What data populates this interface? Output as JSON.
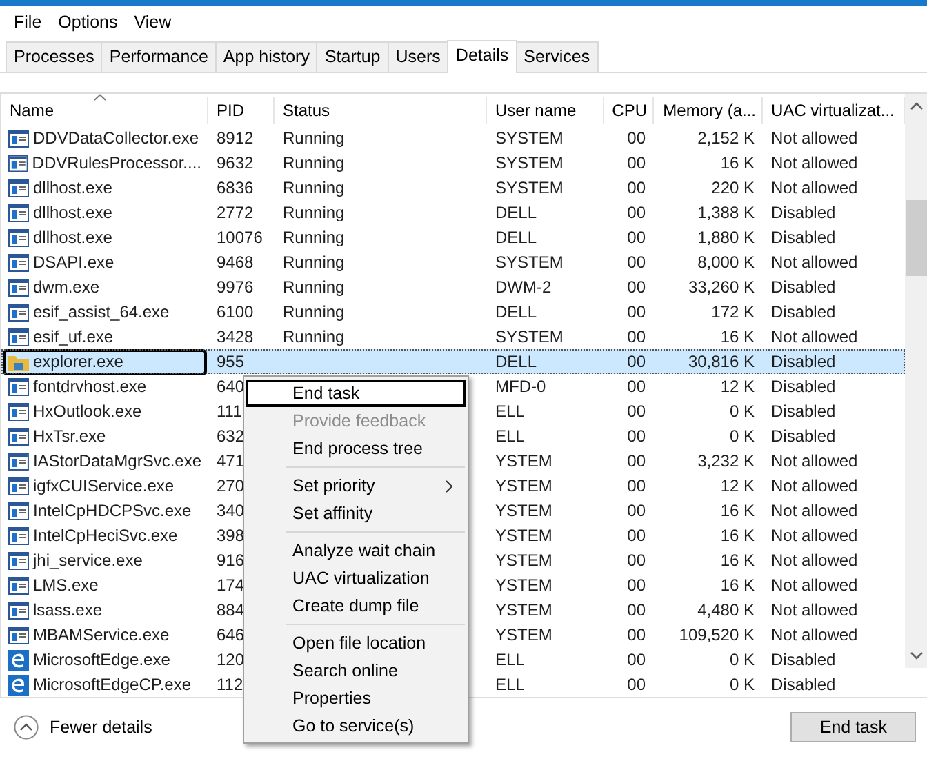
{
  "menu_bar": [
    "File",
    "Options",
    "View"
  ],
  "tabs": [
    {
      "label": "Processes",
      "selected": false
    },
    {
      "label": "Performance",
      "selected": false
    },
    {
      "label": "App history",
      "selected": false
    },
    {
      "label": "Startup",
      "selected": false
    },
    {
      "label": "Users",
      "selected": false
    },
    {
      "label": "Details",
      "selected": true
    },
    {
      "label": "Services",
      "selected": false
    }
  ],
  "table": {
    "columns": [
      "Name",
      "PID",
      "Status",
      "User name",
      "CPU",
      "Memory (a...",
      "UAC virtualizat..."
    ],
    "rows": [
      {
        "kind": "app",
        "selected": false,
        "cells": [
          "DDVDataCollector.exe",
          "8912",
          "Running",
          "SYSTEM",
          "00",
          "2,152 K",
          "Not allowed"
        ]
      },
      {
        "kind": "app",
        "selected": false,
        "cells": [
          "DDVRulesProcessor....",
          "9632",
          "Running",
          "SYSTEM",
          "00",
          "16 K",
          "Not allowed"
        ]
      },
      {
        "kind": "app",
        "selected": false,
        "cells": [
          "dllhost.exe",
          "6836",
          "Running",
          "SYSTEM",
          "00",
          "220 K",
          "Not allowed"
        ]
      },
      {
        "kind": "app",
        "selected": false,
        "cells": [
          "dllhost.exe",
          "2772",
          "Running",
          "DELL",
          "00",
          "1,388 K",
          "Disabled"
        ]
      },
      {
        "kind": "app",
        "selected": false,
        "cells": [
          "dllhost.exe",
          "10076",
          "Running",
          "DELL",
          "00",
          "1,880 K",
          "Disabled"
        ]
      },
      {
        "kind": "app",
        "selected": false,
        "cells": [
          "DSAPI.exe",
          "9468",
          "Running",
          "SYSTEM",
          "00",
          "8,000 K",
          "Not allowed"
        ]
      },
      {
        "kind": "app",
        "selected": false,
        "cells": [
          "dwm.exe",
          "9976",
          "Running",
          "DWM-2",
          "00",
          "33,260 K",
          "Disabled"
        ]
      },
      {
        "kind": "app",
        "selected": false,
        "cells": [
          "esif_assist_64.exe",
          "6100",
          "Running",
          "DELL",
          "00",
          "172 K",
          "Disabled"
        ]
      },
      {
        "kind": "app",
        "selected": false,
        "cells": [
          "esif_uf.exe",
          "3428",
          "Running",
          "SYSTEM",
          "00",
          "16 K",
          "Not allowed"
        ]
      },
      {
        "kind": "folder",
        "selected": true,
        "cells": [
          "explorer.exe",
          "955",
          "",
          "DELL",
          "00",
          "30,816 K",
          "Disabled"
        ]
      },
      {
        "kind": "app",
        "selected": false,
        "cells": [
          "fontdrvhost.exe",
          "640",
          "",
          "MFD-0",
          "00",
          "12 K",
          "Disabled"
        ]
      },
      {
        "kind": "app",
        "selected": false,
        "cells": [
          "HxOutlook.exe",
          "111",
          "",
          "ELL",
          "00",
          "0 K",
          "Disabled"
        ]
      },
      {
        "kind": "app",
        "selected": false,
        "cells": [
          "HxTsr.exe",
          "632",
          "",
          "ELL",
          "00",
          "0 K",
          "Disabled"
        ]
      },
      {
        "kind": "app",
        "selected": false,
        "cells": [
          "IAStorDataMgrSvc.exe",
          "471",
          "",
          "YSTEM",
          "00",
          "3,232 K",
          "Not allowed"
        ]
      },
      {
        "kind": "app",
        "selected": false,
        "cells": [
          "igfxCUIService.exe",
          "270",
          "",
          "YSTEM",
          "00",
          "12 K",
          "Not allowed"
        ]
      },
      {
        "kind": "app",
        "selected": false,
        "cells": [
          "IntelCpHDCPSvc.exe",
          "340",
          "",
          "YSTEM",
          "00",
          "16 K",
          "Not allowed"
        ]
      },
      {
        "kind": "app",
        "selected": false,
        "cells": [
          "IntelCpHeciSvc.exe",
          "398",
          "",
          "YSTEM",
          "00",
          "16 K",
          "Not allowed"
        ]
      },
      {
        "kind": "app",
        "selected": false,
        "cells": [
          "jhi_service.exe",
          "916",
          "",
          "YSTEM",
          "00",
          "16 K",
          "Not allowed"
        ]
      },
      {
        "kind": "app",
        "selected": false,
        "cells": [
          "LMS.exe",
          "174",
          "",
          "YSTEM",
          "00",
          "16 K",
          "Not allowed"
        ]
      },
      {
        "kind": "app",
        "selected": false,
        "cells": [
          "lsass.exe",
          "884",
          "",
          "YSTEM",
          "00",
          "4,480 K",
          "Not allowed"
        ]
      },
      {
        "kind": "app",
        "selected": false,
        "cells": [
          "MBAMService.exe",
          "646",
          "",
          "YSTEM",
          "00",
          "109,520 K",
          "Not allowed"
        ]
      },
      {
        "kind": "edge",
        "selected": false,
        "cells": [
          "MicrosoftEdge.exe",
          "120",
          "",
          "ELL",
          "00",
          "0 K",
          "Disabled"
        ]
      },
      {
        "kind": "edge",
        "selected": false,
        "cells": [
          "MicrosoftEdgeCP.exe",
          "112",
          "",
          "ELL",
          "00",
          "0 K",
          "Disabled"
        ]
      }
    ]
  },
  "context_menu": {
    "groups": [
      [
        {
          "label": "End task",
          "selected": true,
          "disabled": false,
          "submenu": false
        },
        {
          "label": "Provide feedback",
          "selected": false,
          "disabled": true,
          "submenu": false
        },
        {
          "label": "End process tree",
          "selected": false,
          "disabled": false,
          "submenu": false
        }
      ],
      [
        {
          "label": "Set priority",
          "selected": false,
          "disabled": false,
          "submenu": true
        },
        {
          "label": "Set affinity",
          "selected": false,
          "disabled": false,
          "submenu": false
        }
      ],
      [
        {
          "label": "Analyze wait chain",
          "selected": false,
          "disabled": false,
          "submenu": false
        },
        {
          "label": "UAC virtualization",
          "selected": false,
          "disabled": false,
          "submenu": false
        },
        {
          "label": "Create dump file",
          "selected": false,
          "disabled": false,
          "submenu": false
        }
      ],
      [
        {
          "label": "Open file location",
          "selected": false,
          "disabled": false,
          "submenu": false
        },
        {
          "label": "Search online",
          "selected": false,
          "disabled": false,
          "submenu": false
        },
        {
          "label": "Properties",
          "selected": false,
          "disabled": false,
          "submenu": false
        },
        {
          "label": "Go to service(s)",
          "selected": false,
          "disabled": false,
          "submenu": false
        }
      ]
    ]
  },
  "footer": {
    "fewer_details": "Fewer details",
    "end_task": "End task"
  }
}
